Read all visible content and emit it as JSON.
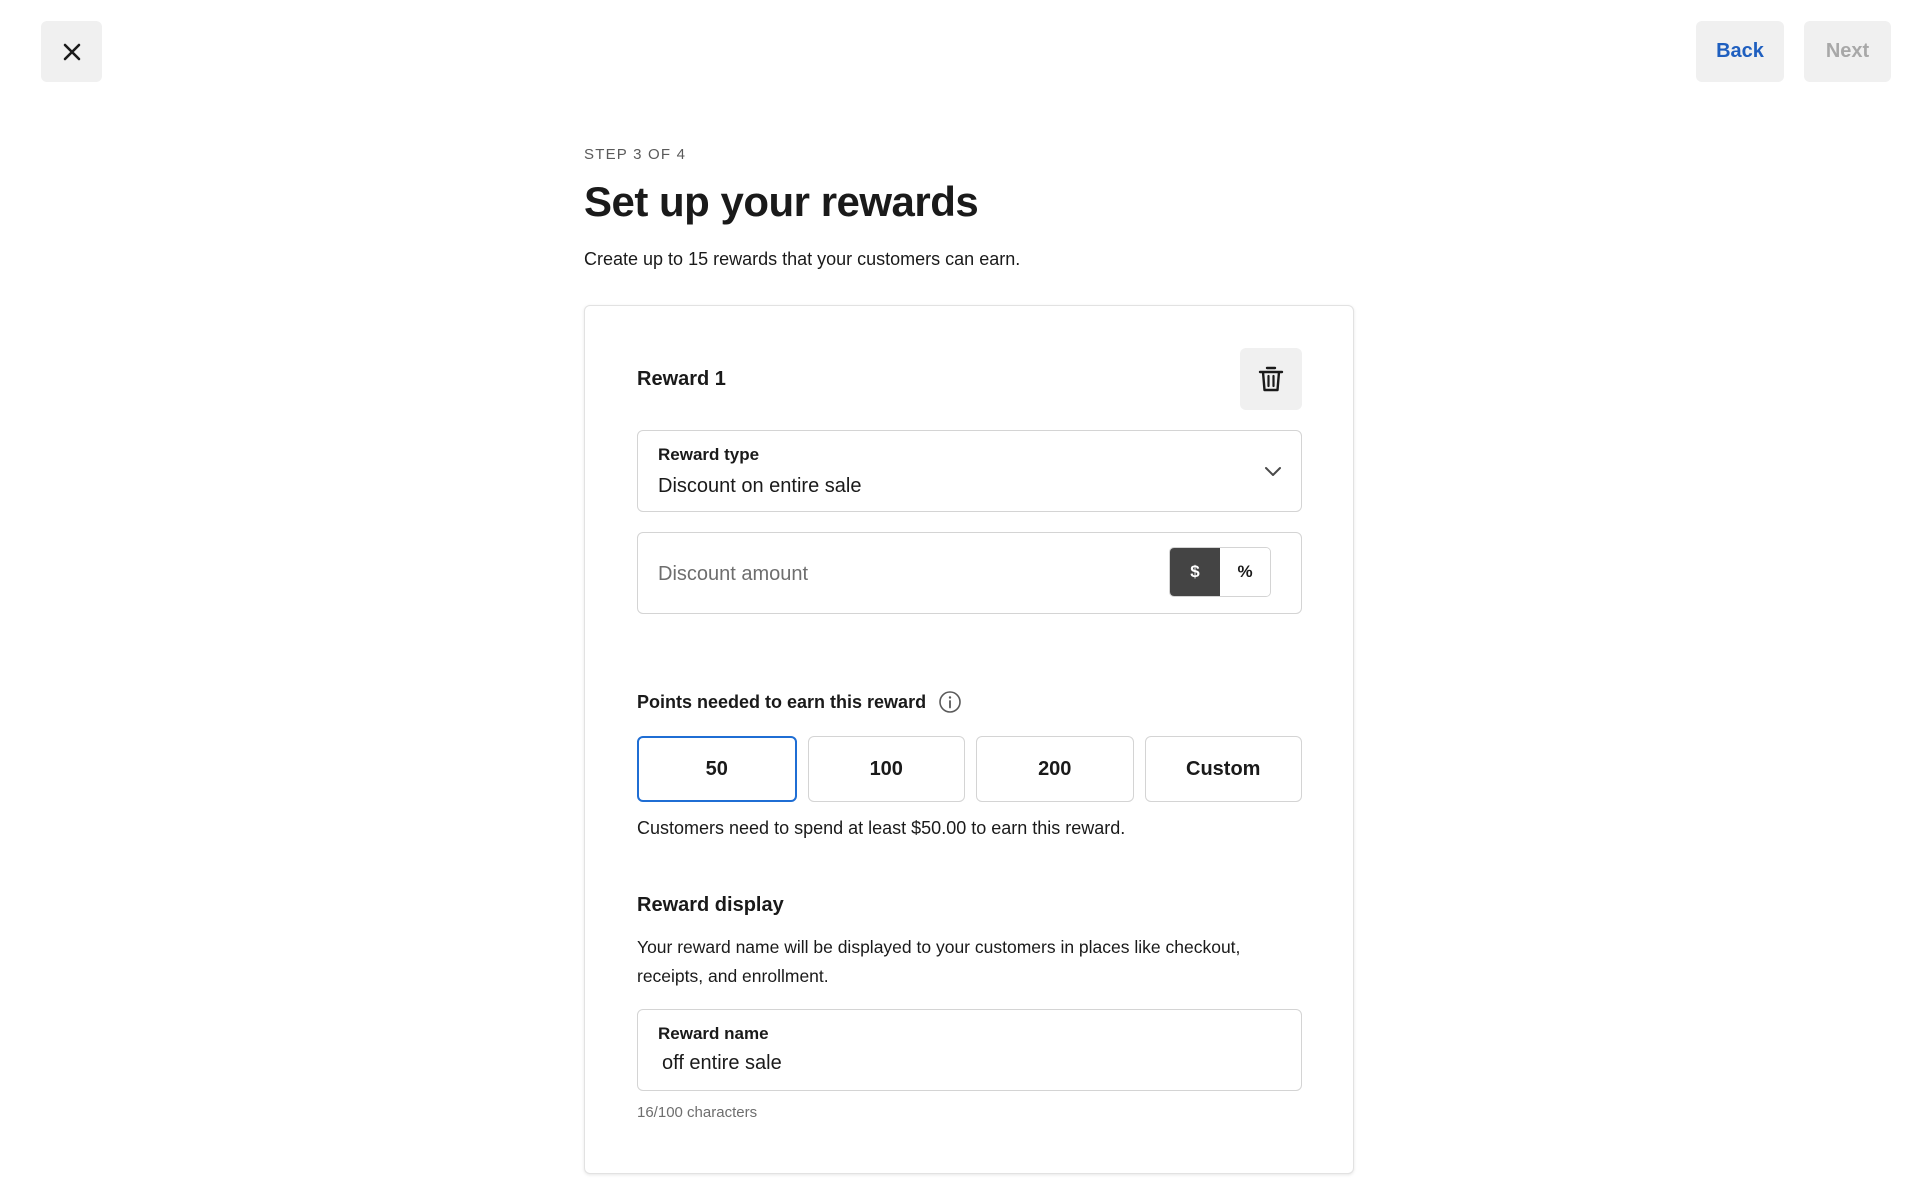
{
  "header": {
    "close_icon": "close-icon",
    "back_label": "Back",
    "next_label": "Next",
    "back_color": "#1f5fbf",
    "next_color_disabled": "#a8a8a8"
  },
  "page": {
    "step": "STEP 3 OF 4",
    "title": "Set up your rewards",
    "subtitle": "Create up to 15 rewards that your customers can earn."
  },
  "reward": {
    "title": "Reward 1",
    "delete_icon": "trash-icon",
    "reward_type": {
      "label": "Reward type",
      "value": "Discount on entire sale",
      "icon": "chevron-down-icon"
    },
    "discount": {
      "placeholder": "Discount amount",
      "value": "",
      "units": [
        {
          "label": "$",
          "selected": true
        },
        {
          "label": "%",
          "selected": false
        }
      ]
    },
    "points": {
      "label": "Points needed to earn this reward",
      "info_icon": "info-icon",
      "options": [
        {
          "label": "50",
          "selected": true
        },
        {
          "label": "100",
          "selected": false
        },
        {
          "label": "200",
          "selected": false
        },
        {
          "label": "Custom",
          "selected": false
        }
      ],
      "note": "Customers need to spend at least $50.00 to earn this reward."
    },
    "display": {
      "title": "Reward display",
      "description": "Your reward name will be displayed to your customers in places like checkout, receipts, and enrollment.",
      "name_field": {
        "label": "Reward name",
        "value": "off entire sale"
      },
      "char_count": "16/100 characters"
    }
  },
  "colors": {
    "accent_blue": "#1f6ed4",
    "toggle_active": "#444444",
    "button_bg": "#f0f0f0"
  }
}
